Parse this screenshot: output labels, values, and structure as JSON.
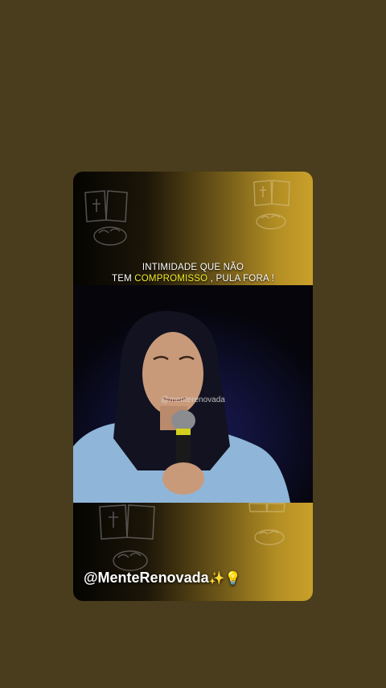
{
  "caption": {
    "line1": "INTIMIDADE QUE NÃO",
    "line2_before": "TEM ",
    "line2_highlight": "COMPROMISSO",
    "line2_after": " , PULA FORA !"
  },
  "watermark": "@menterenovada",
  "handle": {
    "text": "@MenteRenovada",
    "emoji": "✨💡"
  },
  "colors": {
    "background": "#4a3d1d",
    "highlight": "#f3ef2a",
    "gold": "#c9a02a"
  },
  "icons": [
    "bible-icon",
    "bread-icon"
  ]
}
